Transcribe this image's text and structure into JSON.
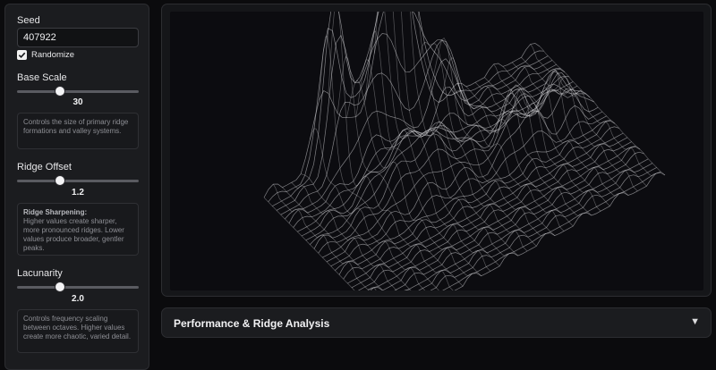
{
  "sidebar": {
    "seed": {
      "label": "Seed",
      "value": "407922"
    },
    "randomize": {
      "label": "Randomize",
      "checked": true
    },
    "base_scale": {
      "label": "Base Scale",
      "value": "30",
      "position": 0.35,
      "description": "Controls the size of primary ridge formations and valley systems."
    },
    "ridge_offset": {
      "label": "Ridge Offset",
      "value": "1.2",
      "position": 0.35,
      "description_heading": "Ridge Sharpening:",
      "description": "Higher values create sharper, more pronounced ridges. Lower values produce broader, gentler peaks."
    },
    "lacunarity": {
      "label": "Lacunarity",
      "value": "2.0",
      "position": 0.35,
      "description": "Controls frequency scaling between octaves. Higher values create more chaotic, varied detail."
    }
  },
  "accordion": {
    "title": "Performance & Ridge Analysis",
    "arrow_icon": "triangle-down-icon"
  },
  "colors": {
    "background": "#0b0b0d",
    "panel": "#1b1c1f",
    "accent": "#f4f4f6"
  }
}
